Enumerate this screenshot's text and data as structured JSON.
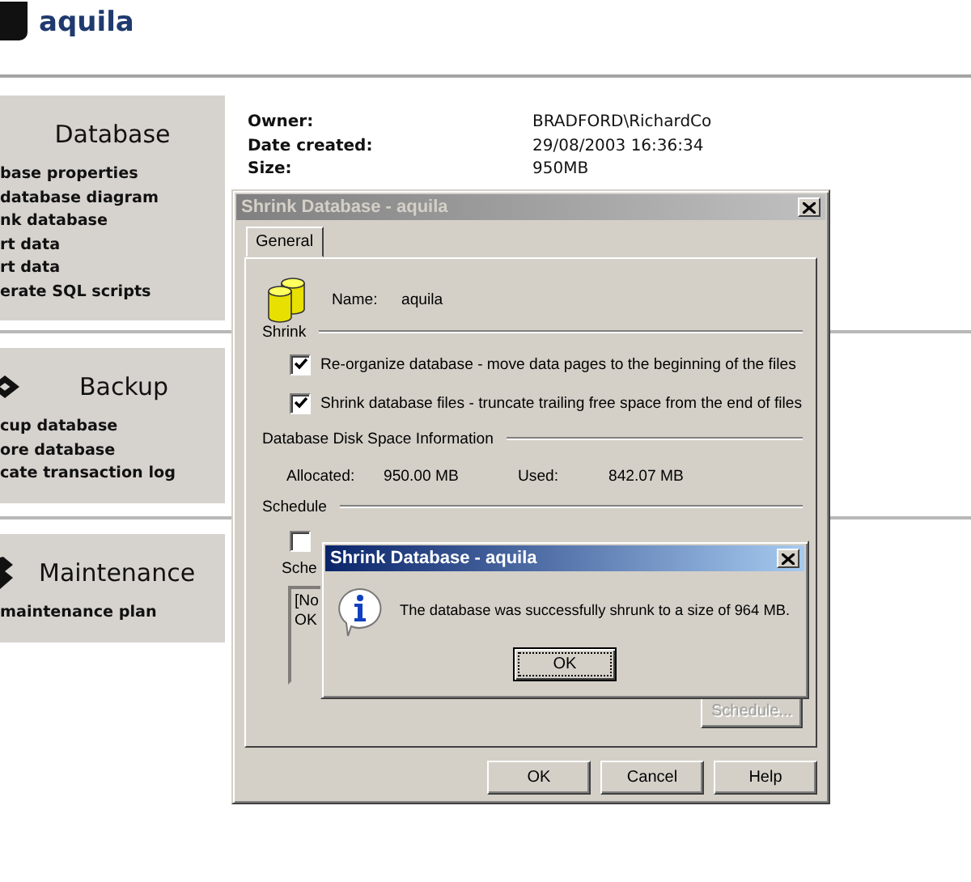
{
  "header": {
    "title": "aquila"
  },
  "sections": [
    {
      "heading": "Database",
      "items": [
        "base properties",
        "database diagram",
        "nk database",
        "rt data",
        "rt data",
        "erate SQL scripts"
      ]
    },
    {
      "heading": "Backup",
      "items": [
        "cup database",
        "ore database",
        "cate transaction log"
      ]
    },
    {
      "heading": "Maintenance",
      "items": [
        "maintenance plan"
      ]
    }
  ],
  "info": [
    {
      "label": "Owner:",
      "value": "BRADFORD\\RichardCo"
    },
    {
      "label": "Date created:",
      "value": "29/08/2003 16:36:34"
    },
    {
      "label": "Size:",
      "value": "950MB"
    }
  ],
  "dialog": {
    "title": "Shrink Database - aquila",
    "active": false,
    "tabs": [
      {
        "label": "General",
        "selected": true
      }
    ],
    "name_label": "Name:",
    "name_value": "aquila",
    "shrink_group": "Shrink",
    "options": [
      {
        "label": "Re-organize database - move data pages to the beginning of the files",
        "checked": true
      },
      {
        "label": "Shrink database files - truncate trailing free space from the end of files",
        "checked": true
      }
    ],
    "space_group": "Database Disk Space Information",
    "allocated_label": "Allocated:",
    "allocated_value": "950.00 MB",
    "used_label": "Used:",
    "used_value": "842.07 MB",
    "schedule_group": "Schedule",
    "schedule_checkbox": {
      "checked": false
    },
    "schedule_label": "Sche",
    "schedule_list": [
      "[No",
      "OK"
    ],
    "schedule_button": {
      "label": "Schedule...",
      "disabled": true
    },
    "buttons": [
      "OK",
      "Cancel",
      "Help"
    ]
  },
  "message_box": {
    "title": "Shrink Database - aquila",
    "active": true,
    "text": "The database was successfully shrunk to a size of 964 MB.",
    "button": "OK"
  }
}
